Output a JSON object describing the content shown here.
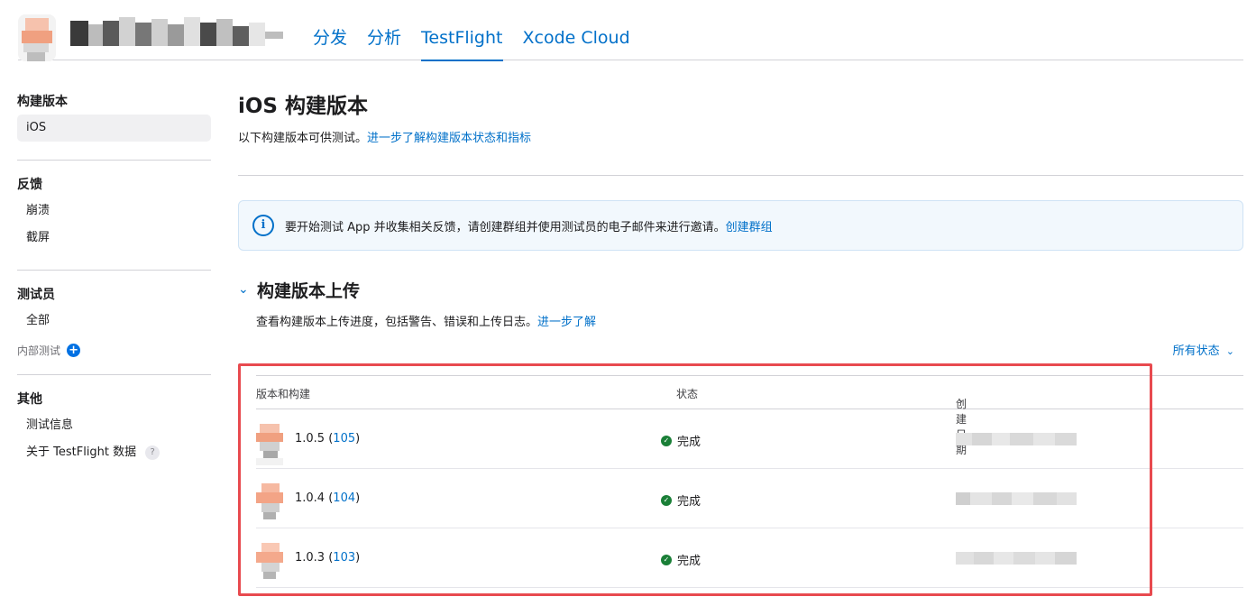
{
  "header": {
    "tabs": [
      {
        "label": "分发",
        "active": false
      },
      {
        "label": "分析",
        "active": false
      },
      {
        "label": "TestFlight",
        "active": true
      },
      {
        "label": "Xcode Cloud",
        "active": false
      }
    ]
  },
  "sidebar": {
    "builds": {
      "heading": "构建版本",
      "items": [
        "iOS"
      ]
    },
    "feedback": {
      "heading": "反馈",
      "items": [
        "崩溃",
        "截屏"
      ]
    },
    "testers": {
      "heading": "测试员",
      "items": [
        "全部"
      ],
      "internal_label": "内部测试"
    },
    "other": {
      "heading": "其他",
      "items": [
        "测试信息",
        "关于 TestFlight 数据"
      ]
    }
  },
  "main": {
    "title": "iOS 构建版本",
    "subtitle": "以下构建版本可供测试。",
    "subtitle_link": "进一步了解构建版本状态和指标",
    "banner_text": "要开始测试 App 并收集相关反馈，请创建群组并使用测试员的电子邮件来进行邀请。",
    "banner_link": "创建群组",
    "section_title": "构建版本上传",
    "section_sub": "查看构建版本上传进度，包括警告、错误和上传日志。",
    "section_link": "进一步了解",
    "filter_label": "所有状态",
    "table": {
      "columns": [
        "版本和构建",
        "状态",
        "创建日期"
      ],
      "rows": [
        {
          "version": "1.0.5",
          "build": "105",
          "status": "完成"
        },
        {
          "version": "1.0.4",
          "build": "104",
          "status": "完成"
        },
        {
          "version": "1.0.3",
          "build": "103",
          "status": "完成"
        }
      ]
    }
  },
  "colors": {
    "accent": "#0070c9",
    "success": "#1a7f37",
    "highlight": "#e84a4f"
  }
}
